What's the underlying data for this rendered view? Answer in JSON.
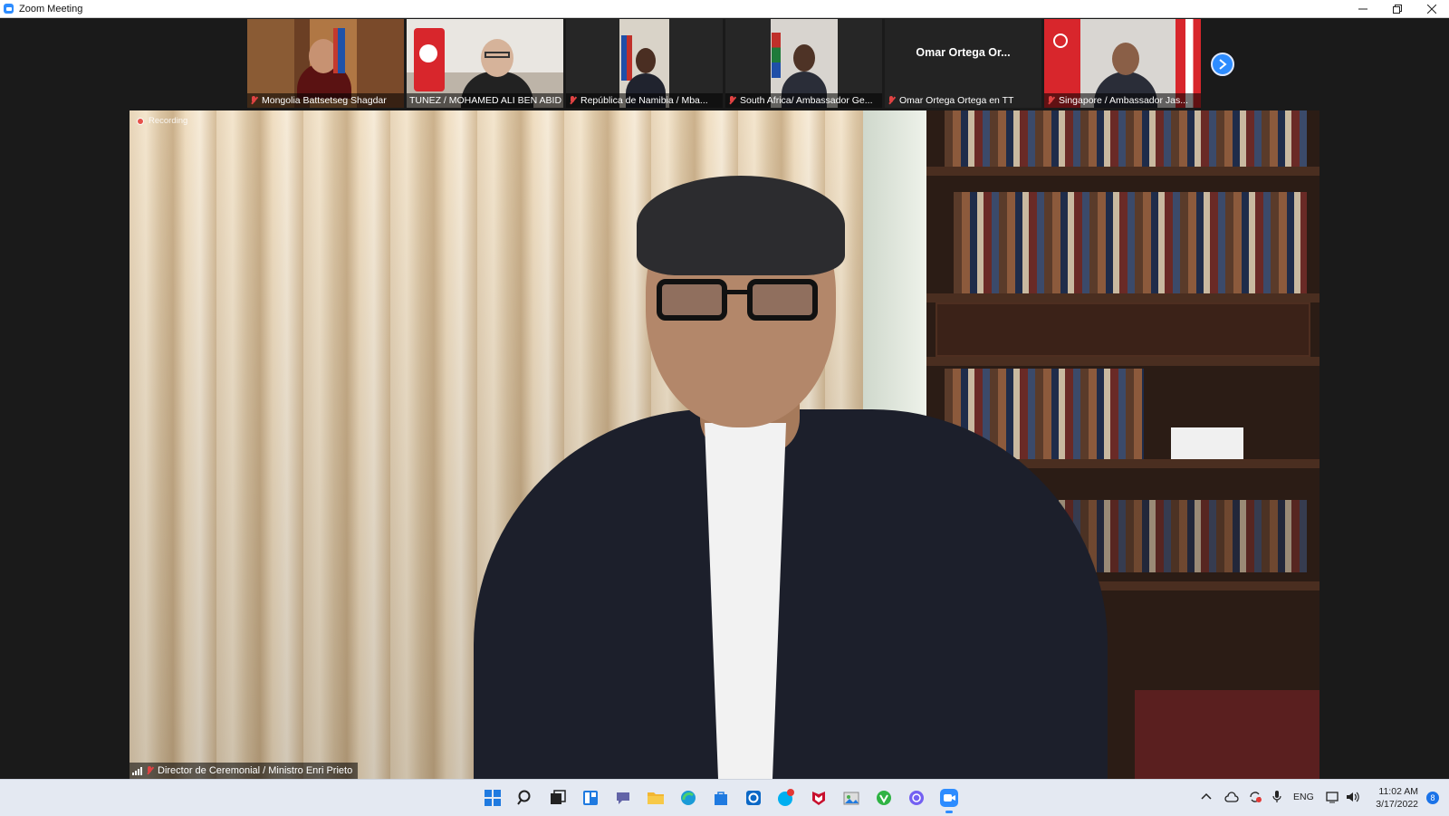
{
  "window": {
    "title": "Zoom Meeting",
    "minimize_icon": "minimize-icon",
    "restore_icon": "restore-icon",
    "close_icon": "close-icon"
  },
  "gallery": {
    "tiles": [
      {
        "name": "Mongolia Battsetseg Shagdar",
        "muted": true,
        "has_video": true
      },
      {
        "name": "TUNEZ / MOHAMED ALI BEN ABID",
        "muted": false,
        "has_video": true
      },
      {
        "name": "República de Namibia / Mba...",
        "muted": true,
        "has_video": true
      },
      {
        "name": "South Africa/ Ambassador Ge...",
        "muted": true,
        "has_video": true
      },
      {
        "name": "Omar Ortega Ortega en TT",
        "muted": true,
        "has_video": false,
        "display_name": "Omar  Ortega  Or..."
      },
      {
        "name": "Singapore / Ambassador Jas...",
        "muted": true,
        "has_video": true
      }
    ],
    "next_page_icon": "chevron-right-icon"
  },
  "main_video": {
    "recording_label": "Recording",
    "speaker_name": "Director de Ceremonial / Ministro Enri Prieto",
    "speaker_muted": true
  },
  "taskbar": {
    "apps": [
      "windows-start-icon",
      "search-icon",
      "task-view-icon",
      "widgets-icon",
      "chat-icon",
      "file-explorer-icon",
      "edge-icon",
      "store-icon",
      "app-icon",
      "skype-icon",
      "mcafee-icon",
      "photos-icon",
      "vpn-icon",
      "viber-icon",
      "zoom-icon"
    ],
    "active_app": "zoom-icon",
    "tray": {
      "language": "ENG",
      "time": "11:02 AM",
      "date": "3/17/2022",
      "notifications": "8"
    }
  },
  "colors": {
    "accent": "#2d8cff",
    "muted_red": "#e04343",
    "background": "#1a1a1a"
  }
}
